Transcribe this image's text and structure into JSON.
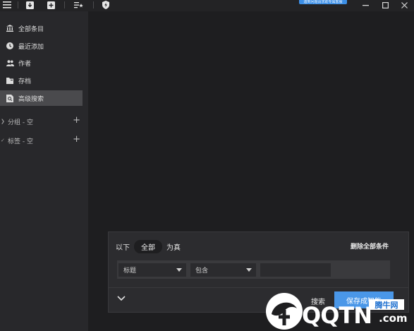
{
  "toolbar": {
    "icons": [
      "menu-icon",
      "import-icon",
      "add-icon",
      "list-star-icon",
      "shield-bolt-icon"
    ],
    "badge_text": "遇到问题请求助专属客服",
    "window_controls": [
      "minimize",
      "maximize",
      "close"
    ]
  },
  "sidebar": {
    "items": [
      {
        "label": "全部条目",
        "icon": "library-icon"
      },
      {
        "label": "最近添加",
        "icon": "clock-icon"
      },
      {
        "label": "作者",
        "icon": "people-icon"
      },
      {
        "label": "存档",
        "icon": "archive-icon"
      },
      {
        "label": "高级搜索",
        "icon": "advanced-search-icon",
        "active": true
      }
    ],
    "groups": [
      {
        "label": "分组 - 空"
      },
      {
        "label": "标签 - 空"
      }
    ]
  },
  "search_panel": {
    "prefix": "以下",
    "match_mode": "全部",
    "suffix": "为真",
    "delete_all": "删除全部条件",
    "field_select": "标题",
    "operator_select": "包含",
    "value": "",
    "search_label": "搜索",
    "save_label": "保存成智能"
  },
  "watermark": {
    "brand": "QQTN",
    "badge": "腾牛网",
    "suffix": ".com"
  }
}
